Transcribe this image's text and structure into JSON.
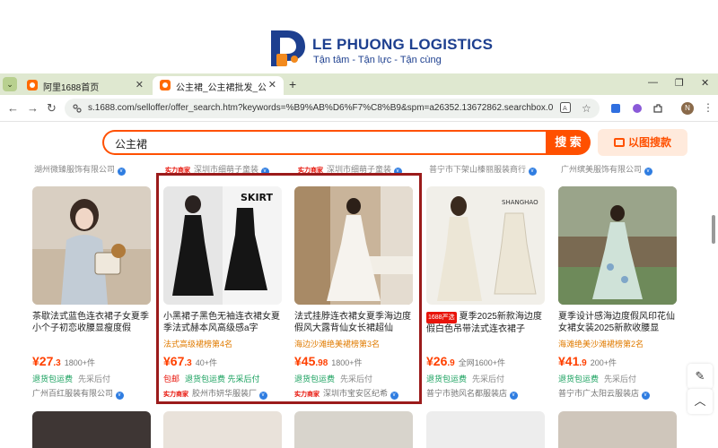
{
  "brand": {
    "name": "LE PHUONG LOGISTICS",
    "tagline": "Tận tâm - Tận lực - Tận cùng",
    "color": "#1d3f8f"
  },
  "browser": {
    "tabs": [
      {
        "label": "阿里1688首页",
        "active": false
      },
      {
        "label": "公主裙_公主裙批发_公主裙供应...",
        "active": true
      }
    ],
    "url": "s.1688.com/selloffer/offer_search.htm?keywords=%B9%AB%D6%F7%C8%B9&spm=a26352.13672862.searchbox.0",
    "avatar_letter": "N",
    "icons": [
      "back-icon",
      "forward-icon",
      "reload-icon",
      "translate-icon",
      "star-icon",
      "extension-icon",
      "puzzle-icon",
      "sidebar-icon",
      "menu-icon"
    ]
  },
  "search": {
    "value": "公主裙",
    "button_label": "搜 索",
    "image_search_label": "以图搜款",
    "accent": "#ff5000"
  },
  "previous_row": [
    {
      "shop": "湖州微臻服饰有限公司",
      "badge": ""
    },
    {
      "shop": "深圳市细萌子童装",
      "badge": "实力商家"
    },
    {
      "shop": "深圳市细萌子童装",
      "badge": "实力商家"
    },
    {
      "shop": "普宁市下架山榛丽服装商行",
      "badge": ""
    },
    {
      "shop": "广州缤美服饰有限公司",
      "badge": ""
    }
  ],
  "products": [
    {
      "title": "茶歇法式蓝色连衣裙子女夏季小个子初恋收腰显瘦度假",
      "rank": "",
      "tag_1688": false,
      "price_int": "27",
      "price_dec": ".3",
      "sold": "1800+件",
      "perk1": "退货包运费",
      "perk1_style": "green",
      "perk2": "先采后付",
      "shop": "广州百红服装有限公司",
      "badge": ""
    },
    {
      "title": "小黑裙子黑色无袖连衣裙女夏季法式赫本风高级感a字",
      "rank": "法式高级裙榜第4名",
      "tag_1688": false,
      "price_int": "67",
      "price_dec": ".3",
      "sold": "40+件",
      "perk1": "包邮",
      "perk1_style": "red",
      "perk2": "退货包运费 先采后付",
      "shop": "胶州市妍华服装厂",
      "badge": "实力商家",
      "img_text": "SKIRT"
    },
    {
      "title": "法式挂脖连衣裙女夏季海边度假风大露背仙女长裙超仙",
      "rank": "海边沙滩绝美裙榜第3名",
      "tag_1688": false,
      "price_int": "45",
      "price_dec": ".98",
      "sold": "1800+件",
      "perk1": "退货包运费",
      "perk1_style": "green",
      "perk2": "先采后付",
      "shop": "深圳市宝安区纪希",
      "badge": "实力商家"
    },
    {
      "title": "夏季2025新款海边度假白色吊带法式连衣裙子",
      "rank": "",
      "tag_1688": true,
      "tag_1688_label": "1688严选",
      "price_int": "26",
      "price_dec": ".9",
      "sold": "全网1600+件",
      "perk1": "退货包运费",
      "perk1_style": "green",
      "perk2": "先采后付",
      "shop": "普宁市驰风名都服装店",
      "badge": "",
      "img_text": "SHANGHAO"
    },
    {
      "title": "夏季设计感海边度假风印花仙女裙女装2025新款收腰显",
      "rank": "海滩绝美沙滩裙榜第2名",
      "tag_1688": false,
      "price_int": "41",
      "price_dec": ".9",
      "sold": "200+件",
      "perk1": "退货包运费",
      "perk1_style": "green",
      "perk2": "先采后付",
      "shop": "普宁市广太阳云服装店",
      "badge": ""
    }
  ],
  "side_tools": [
    "edit-icon",
    "back-to-top-icon"
  ]
}
